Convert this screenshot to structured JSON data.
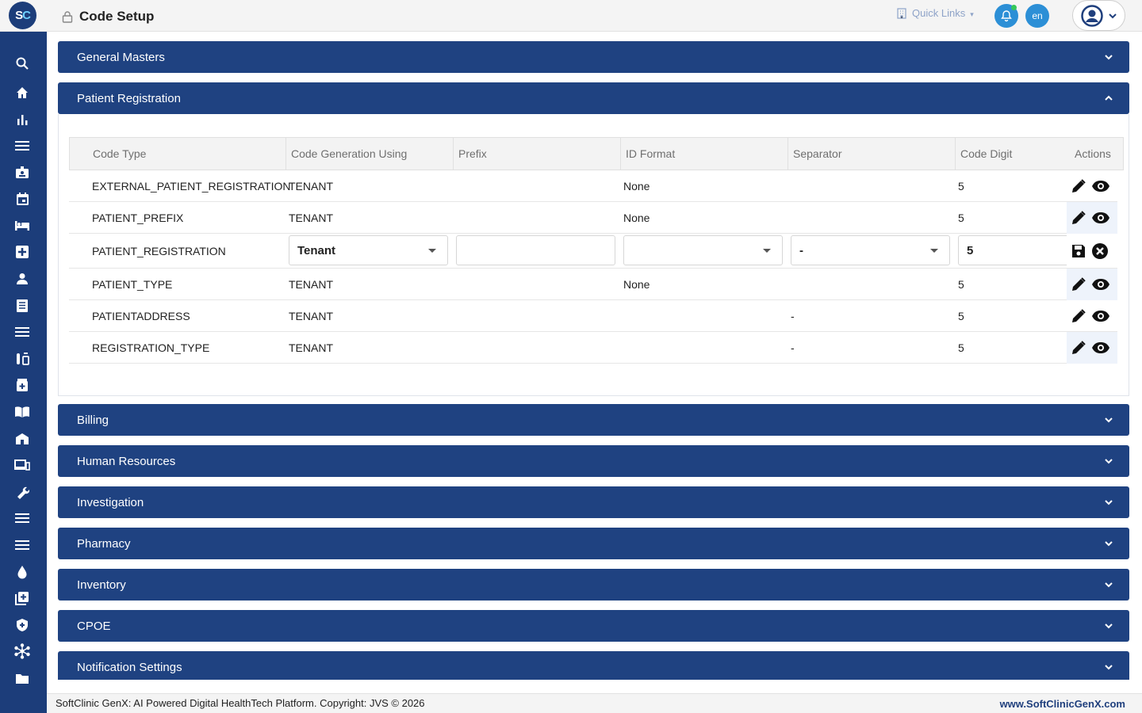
{
  "app": {
    "logo_text_s": "S",
    "logo_text_c": "C",
    "page_title": "Code Setup",
    "quick_links": "Quick Links",
    "lang": "en"
  },
  "sidebar": {
    "icons": [
      "search-icon",
      "home-icon",
      "bar-chart-icon",
      "menu-icon",
      "badge-icon",
      "calendar-icon",
      "bed-icon",
      "medical-plus-icon",
      "person-icon",
      "list-document-icon",
      "menu-icon",
      "lab-icon",
      "pharmacy-box-icon",
      "book-icon",
      "building-icon",
      "devices-icon",
      "wrench-icon",
      "menu-icon",
      "menu-icon",
      "drop-icon",
      "library-add-icon",
      "shield-plus-icon",
      "network-icon",
      "folder-icon"
    ]
  },
  "panels": {
    "general_masters": "General Masters",
    "patient_registration": "Patient Registration",
    "billing": "Billing",
    "human_resources": "Human Resources",
    "investigation": "Investigation",
    "pharmacy": "Pharmacy",
    "inventory": "Inventory",
    "cpoe": "CPOE",
    "notification_settings": "Notification Settings"
  },
  "table": {
    "headers": {
      "code_type": "Code Type",
      "code_generation": "Code Generation Using",
      "prefix": "Prefix",
      "id_format": "ID Format",
      "separator": "Separator",
      "code_digit": "Code Digit",
      "actions": "Actions"
    },
    "rows": [
      {
        "code_type": "EXTERNAL_PATIENT_REGISTRATION",
        "code_generation": "TENANT",
        "prefix": "",
        "id_format": "None",
        "separator": "",
        "code_digit": "5"
      },
      {
        "code_type": "PATIENT_PREFIX",
        "code_generation": "TENANT",
        "prefix": "",
        "id_format": "None",
        "separator": "",
        "code_digit": "5"
      },
      {
        "code_type": "PATIENT_REGISTRATION",
        "code_generation": "Tenant",
        "prefix": "",
        "id_format": "",
        "separator": "-",
        "code_digit": "5"
      },
      {
        "code_type": "PATIENT_TYPE",
        "code_generation": "TENANT",
        "prefix": "",
        "id_format": "None",
        "separator": "",
        "code_digit": "5"
      },
      {
        "code_type": "PATIENTADDRESS",
        "code_generation": "TENANT",
        "prefix": "",
        "id_format": "",
        "separator": "-",
        "code_digit": "5"
      },
      {
        "code_type": "REGISTRATION_TYPE",
        "code_generation": "TENANT",
        "prefix": "",
        "id_format": "",
        "separator": "-",
        "code_digit": "5"
      }
    ]
  },
  "footer": {
    "copyright": "SoftClinic GenX: AI Powered Digital HealthTech Platform. Copyright: JVS © 2026",
    "website": "www.SoftClinicGenX.com"
  },
  "colors": {
    "primary": "#1f4281",
    "sidebar": "#1c3d7a",
    "accent": "#2c8fd6"
  }
}
